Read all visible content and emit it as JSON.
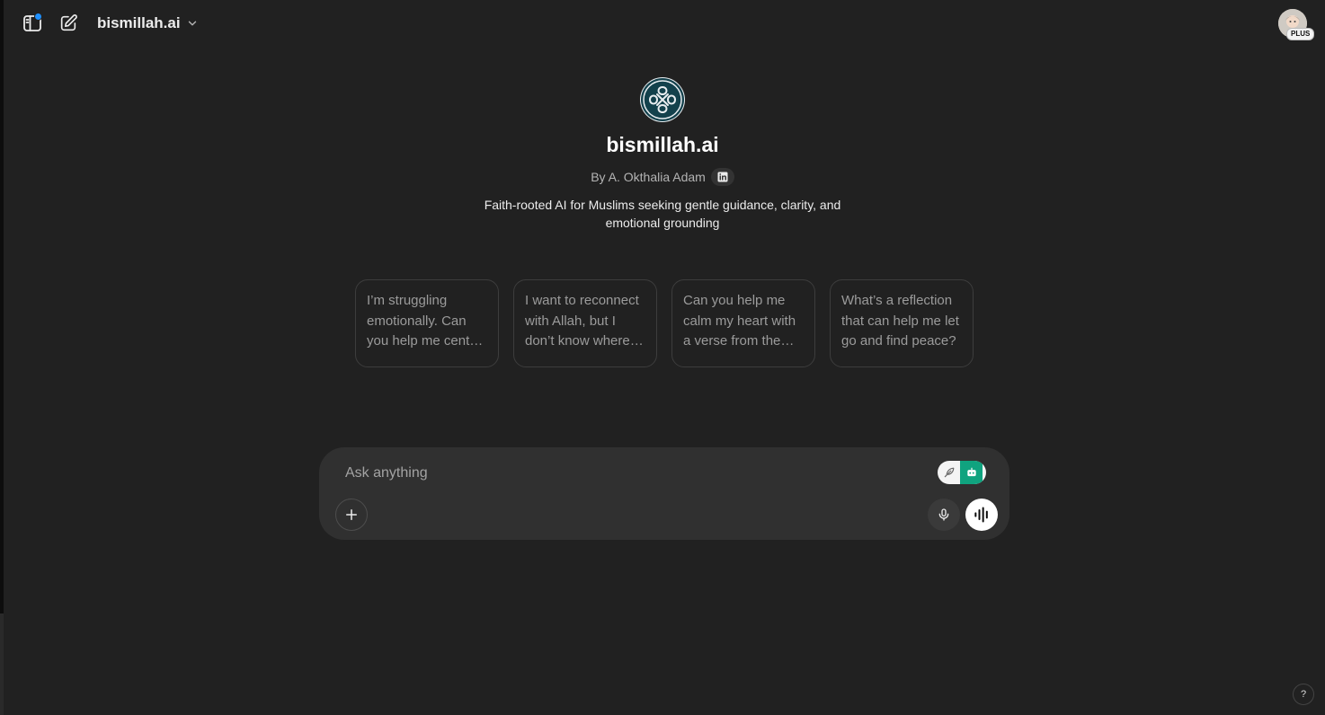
{
  "header": {
    "gpt_title": "bismillah.ai",
    "avatar_badge": "PLUS"
  },
  "gpt": {
    "name": "bismillah.ai",
    "author": "By A. Okthalia Adam",
    "description": "Faith-rooted AI for Muslims seeking gentle guidance, clarity, and emotional grounding",
    "brand_color": "#13414c"
  },
  "starters": [
    {
      "text": "I’m struggling emotionally. Can you help me center myself through faith?"
    },
    {
      "text": "I want to reconnect with Allah, but I don’t know where to begin."
    },
    {
      "text": "Can you help me calm my heart with a verse from the Quran?"
    },
    {
      "text": "What’s a reflection that can help me let go and find peace?"
    }
  ],
  "composer": {
    "placeholder": "Ask anything"
  },
  "help": {
    "label": "?"
  },
  "icons": {
    "sidebar_toggle": "sidebar-icon",
    "new_chat": "compose-icon",
    "model_dropdown": "chevron-down-icon",
    "linkedin": "linkedin-icon",
    "attach": "plus-icon",
    "dictate": "microphone-icon",
    "voice_mode": "waveform-icon",
    "toggle_left": "feather-icon",
    "toggle_right": "robot-icon"
  },
  "colors": {
    "background": "#212121",
    "composer": "#303030",
    "notification_dot": "#1e90ff",
    "toggle_accent": "#10a37f"
  }
}
